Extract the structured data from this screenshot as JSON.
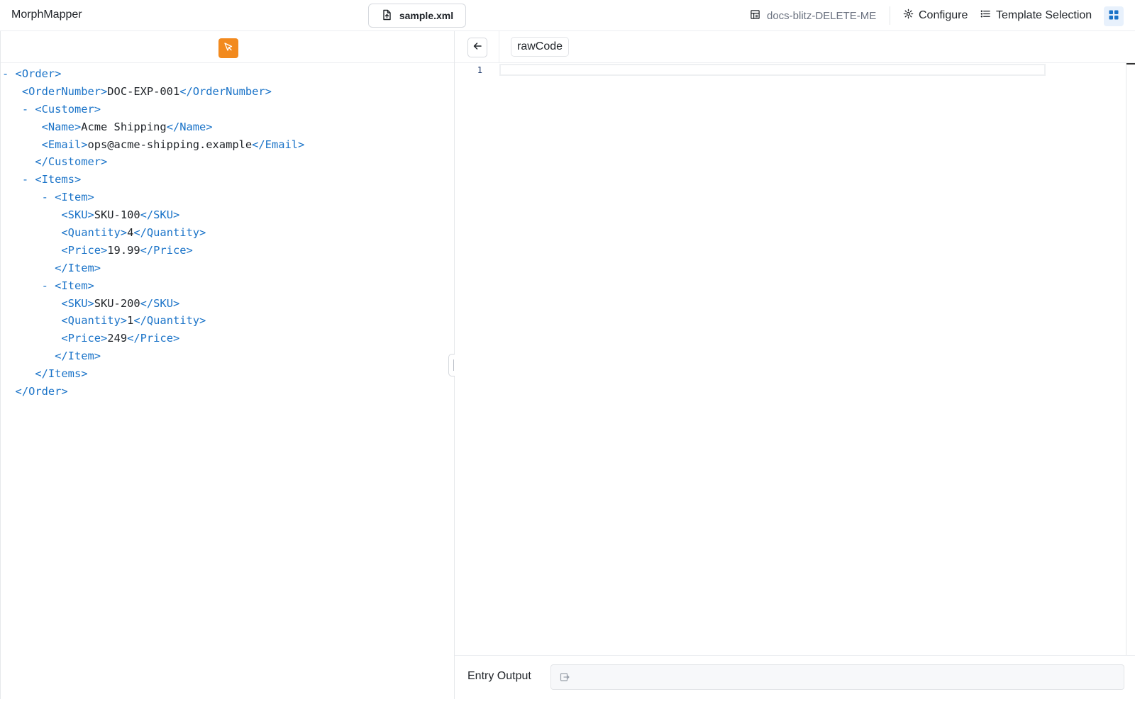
{
  "header": {
    "app_title": "MorphMapper",
    "file_button": "sample.xml",
    "project_name": "docs-blitz-DELETE-ME",
    "configure": "Configure",
    "template_selection": "Template Selection"
  },
  "xml_tree": [
    [
      {
        "c": "toggle",
        "t": "- "
      },
      {
        "c": "tag",
        "t": "<Order>"
      }
    ],
    [
      {
        "c": "txt",
        "t": "   "
      },
      {
        "c": "tag",
        "t": "<OrderNumber>"
      },
      {
        "c": "txt",
        "t": "DOC-EXP-001"
      },
      {
        "c": "tag",
        "t": "</OrderNumber>"
      }
    ],
    [
      {
        "c": "txt",
        "t": "   "
      },
      {
        "c": "toggle",
        "t": "- "
      },
      {
        "c": "tag",
        "t": "<Customer>"
      }
    ],
    [
      {
        "c": "txt",
        "t": "      "
      },
      {
        "c": "tag",
        "t": "<Name>"
      },
      {
        "c": "txt",
        "t": "Acme Shipping"
      },
      {
        "c": "tag",
        "t": "</Name>"
      }
    ],
    [
      {
        "c": "txt",
        "t": "      "
      },
      {
        "c": "tag",
        "t": "<Email>"
      },
      {
        "c": "txt",
        "t": "ops@acme-shipping.example"
      },
      {
        "c": "tag",
        "t": "</Email>"
      }
    ],
    [
      {
        "c": "txt",
        "t": "     "
      },
      {
        "c": "tag",
        "t": "</Customer>"
      }
    ],
    [
      {
        "c": "txt",
        "t": "   "
      },
      {
        "c": "toggle",
        "t": "- "
      },
      {
        "c": "tag",
        "t": "<Items>"
      }
    ],
    [
      {
        "c": "txt",
        "t": "      "
      },
      {
        "c": "toggle",
        "t": "- "
      },
      {
        "c": "tag",
        "t": "<Item>"
      }
    ],
    [
      {
        "c": "txt",
        "t": "         "
      },
      {
        "c": "tag",
        "t": "<SKU>"
      },
      {
        "c": "txt",
        "t": "SKU-100"
      },
      {
        "c": "tag",
        "t": "</SKU>"
      }
    ],
    [
      {
        "c": "txt",
        "t": "         "
      },
      {
        "c": "tag",
        "t": "<Quantity>"
      },
      {
        "c": "txt",
        "t": "4"
      },
      {
        "c": "tag",
        "t": "</Quantity>"
      }
    ],
    [
      {
        "c": "txt",
        "t": "         "
      },
      {
        "c": "tag",
        "t": "<Price>"
      },
      {
        "c": "txt",
        "t": "19.99"
      },
      {
        "c": "tag",
        "t": "</Price>"
      }
    ],
    [
      {
        "c": "txt",
        "t": "        "
      },
      {
        "c": "tag",
        "t": "</Item>"
      }
    ],
    [
      {
        "c": "txt",
        "t": "      "
      },
      {
        "c": "toggle",
        "t": "- "
      },
      {
        "c": "tag",
        "t": "<Item>"
      }
    ],
    [
      {
        "c": "txt",
        "t": "         "
      },
      {
        "c": "tag",
        "t": "<SKU>"
      },
      {
        "c": "txt",
        "t": "SKU-200"
      },
      {
        "c": "tag",
        "t": "</SKU>"
      }
    ],
    [
      {
        "c": "txt",
        "t": "         "
      },
      {
        "c": "tag",
        "t": "<Quantity>"
      },
      {
        "c": "txt",
        "t": "1"
      },
      {
        "c": "tag",
        "t": "</Quantity>"
      }
    ],
    [
      {
        "c": "txt",
        "t": "         "
      },
      {
        "c": "tag",
        "t": "<Price>"
      },
      {
        "c": "txt",
        "t": "249"
      },
      {
        "c": "tag",
        "t": "</Price>"
      }
    ],
    [
      {
        "c": "txt",
        "t": "        "
      },
      {
        "c": "tag",
        "t": "</Item>"
      }
    ],
    [
      {
        "c": "txt",
        "t": "     "
      },
      {
        "c": "tag",
        "t": "</Items>"
      }
    ],
    [
      {
        "c": "txt",
        "t": "  "
      },
      {
        "c": "tag",
        "t": "</Order>"
      }
    ]
  ],
  "right_panel": {
    "tab_label": "rawCode",
    "line_numbers": [
      "1"
    ],
    "output_label": "Entry Output",
    "output_value": ""
  },
  "icons": {
    "file": "file-upload-icon",
    "project": "project-icon",
    "configure": "gear-icon",
    "template": "list-icon",
    "layout": "grid-layout-icon",
    "select": "cursor-select-icon",
    "back": "arrow-left-icon",
    "output": "output-field-icon"
  },
  "colors": {
    "accent_orange": "#f28a1e",
    "tag_blue": "#1a73c8",
    "layout_blue": "#1a73c8"
  }
}
